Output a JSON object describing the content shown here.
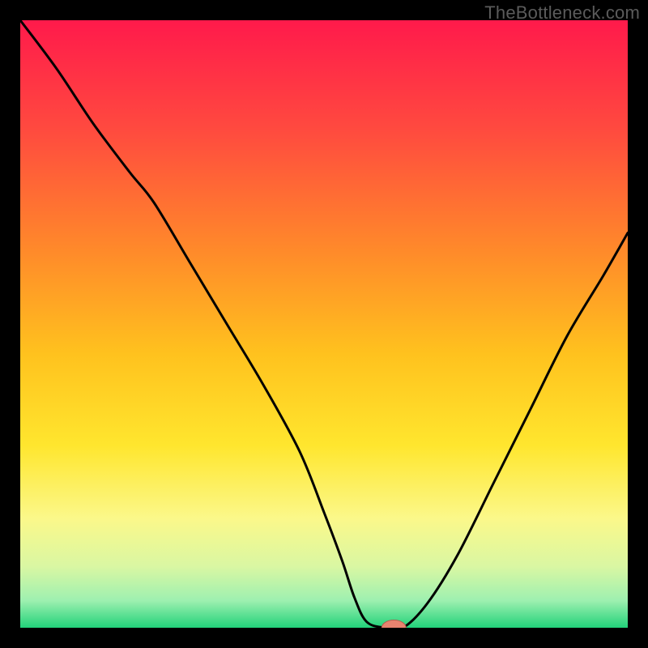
{
  "watermark": "TheBottleneck.com",
  "colors": {
    "frame_bg": "#000000",
    "curve": "#000000",
    "marker_fill": "#e8836f",
    "marker_stroke": "#b55c4d",
    "gradient_stops": [
      {
        "offset": 0.0,
        "color": "#ff1a4b"
      },
      {
        "offset": 0.18,
        "color": "#ff4a3f"
      },
      {
        "offset": 0.38,
        "color": "#ff8a2a"
      },
      {
        "offset": 0.55,
        "color": "#ffc21e"
      },
      {
        "offset": 0.7,
        "color": "#ffe62e"
      },
      {
        "offset": 0.82,
        "color": "#fbf88a"
      },
      {
        "offset": 0.9,
        "color": "#d9f7a3"
      },
      {
        "offset": 0.955,
        "color": "#9ef0b0"
      },
      {
        "offset": 1.0,
        "color": "#22d27a"
      }
    ]
  },
  "chart_data": {
    "type": "line",
    "title": "",
    "xlabel": "",
    "ylabel": "",
    "xlim": [
      0,
      100
    ],
    "ylim": [
      0,
      100
    ],
    "grid": false,
    "series": [
      {
        "name": "bottleneck-curve",
        "x": [
          0,
          6,
          12,
          18,
          22,
          28,
          34,
          40,
          46,
          50,
          53,
          55,
          57,
          60,
          63,
          67,
          72,
          78,
          84,
          90,
          96,
          100
        ],
        "values": [
          100,
          92,
          83,
          75,
          70,
          60,
          50,
          40,
          29,
          19,
          11,
          5,
          1,
          0,
          0,
          4,
          12,
          24,
          36,
          48,
          58,
          65
        ]
      }
    ],
    "marker": {
      "x": 61.5,
      "y": 0,
      "rx": 2.0,
      "ry": 1.0
    }
  }
}
